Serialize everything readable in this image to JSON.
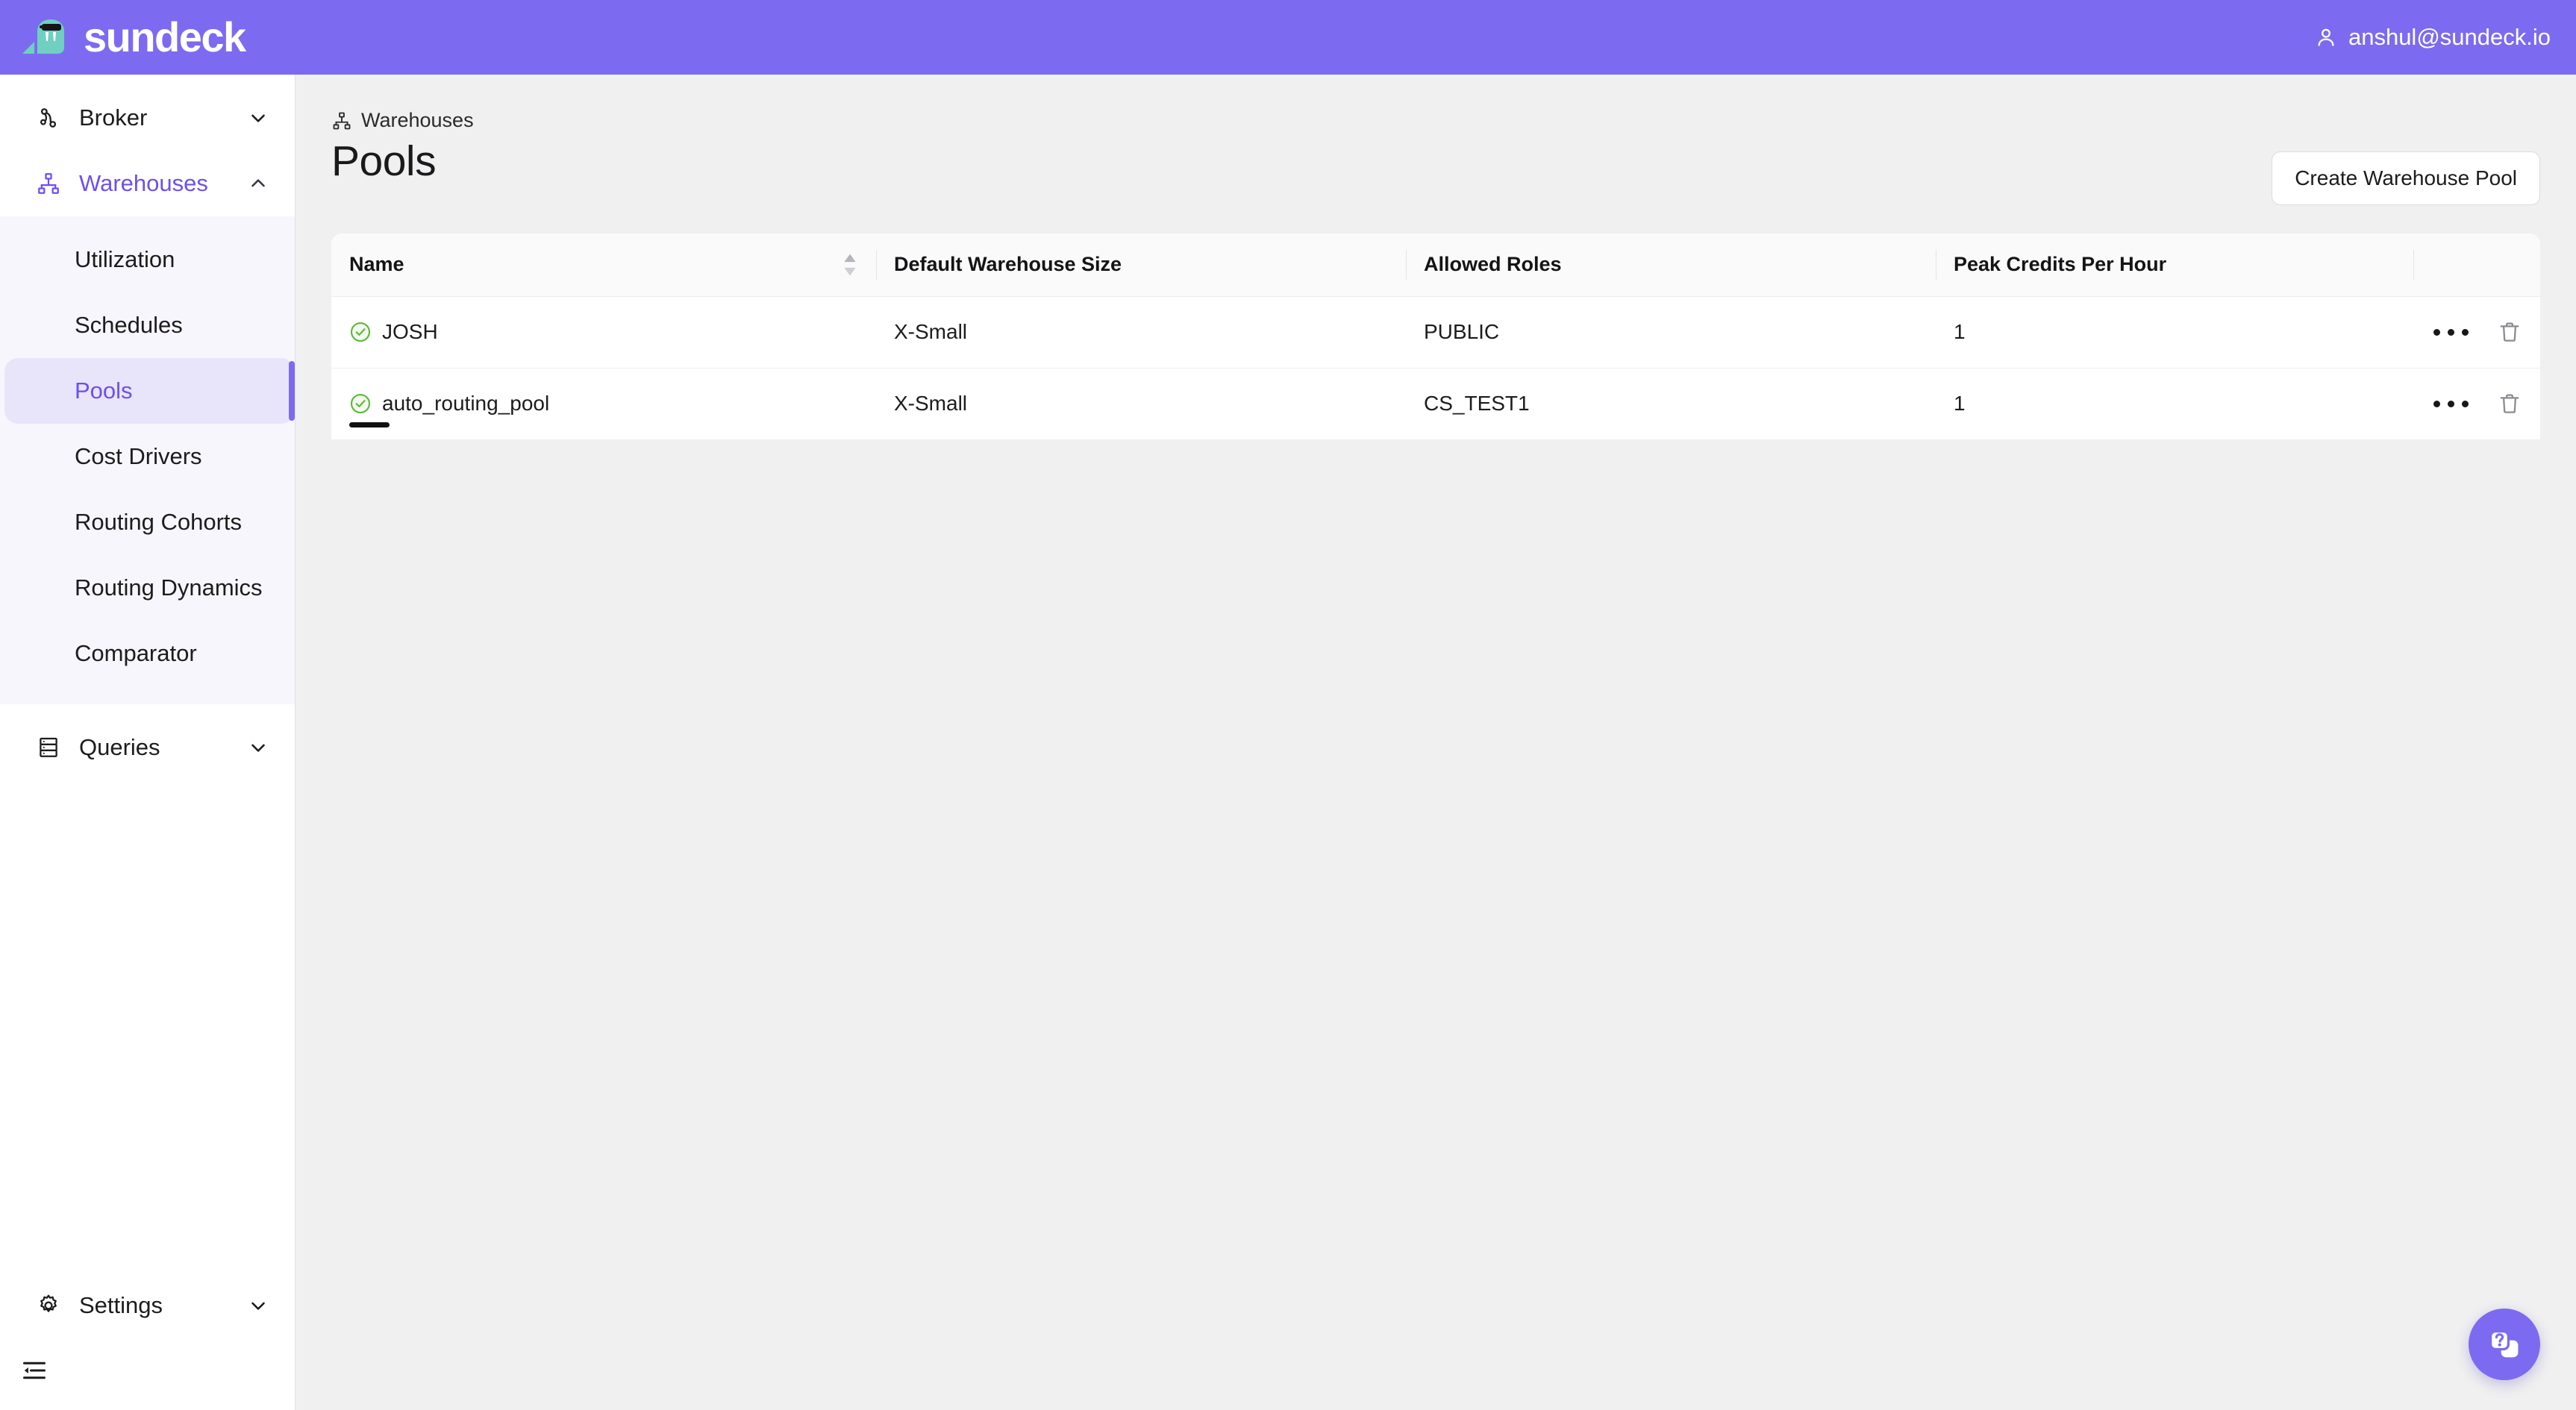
{
  "brand": {
    "name": "sundeck",
    "logo_icon": "walrus-logo-icon"
  },
  "topbar": {
    "user_icon": "user-icon",
    "user_email": "anshul@sundeck.io",
    "background_color": "#7c6bf0"
  },
  "sidebar": {
    "groups": [
      {
        "label": "Broker",
        "icon": "broker-nodes-icon",
        "chevron": "chevron-down-icon",
        "expanded": false,
        "active": false
      },
      {
        "label": "Warehouses",
        "icon": "warehouses-hierarchy-icon",
        "chevron": "chevron-up-icon",
        "expanded": true,
        "active": true
      }
    ],
    "submenu": [
      {
        "label": "Utilization",
        "active": false
      },
      {
        "label": "Schedules",
        "active": false
      },
      {
        "label": "Pools",
        "active": true
      },
      {
        "label": "Cost Drivers",
        "active": false
      },
      {
        "label": "Routing Cohorts",
        "active": false
      },
      {
        "label": "Routing Dynamics",
        "active": false
      },
      {
        "label": "Comparator",
        "active": false
      }
    ],
    "queries": {
      "label": "Queries",
      "icon": "server-stack-icon",
      "chevron": "chevron-down-icon"
    },
    "settings": {
      "label": "Settings",
      "icon": "gear-icon",
      "chevron": "chevron-down-icon"
    },
    "collapse": {
      "icon": "collapse-sidebar-icon"
    },
    "accent_color": "#6c4ff0",
    "submenu_background": "#f8f6fd",
    "active_item_background": "#e8e5fa"
  },
  "main": {
    "breadcrumb": {
      "icon": "warehouses-hierarchy-icon",
      "label": "Warehouses"
    },
    "page_title": "Pools",
    "create_button": "Create Warehouse Pool"
  },
  "table": {
    "columns": [
      {
        "key": "name",
        "label": "Name",
        "sortable": true,
        "sort_icon": "sort-arrows-icon"
      },
      {
        "key": "size",
        "label": "Default Warehouse Size",
        "sortable": false
      },
      {
        "key": "roles",
        "label": "Allowed Roles",
        "sortable": false
      },
      {
        "key": "peak",
        "label": "Peak Credits Per Hour",
        "sortable": false
      },
      {
        "key": "actions",
        "label": "",
        "sortable": false
      }
    ],
    "rows": [
      {
        "status_icon": "check-circle-icon",
        "status_color": "#5cb83c",
        "name": "JOSH",
        "size": "X-Small",
        "roles": "PUBLIC",
        "peak": "1",
        "menu_icon": "more-options-icon",
        "delete_icon": "trash-icon",
        "caret": false
      },
      {
        "status_icon": "check-circle-icon",
        "status_color": "#5cb83c",
        "name": "auto_routing_pool",
        "size": "X-Small",
        "roles": "CS_TEST1",
        "peak": "1",
        "menu_icon": "more-options-icon",
        "delete_icon": "trash-icon",
        "caret": true
      }
    ]
  },
  "help_fab": {
    "icon": "help-cards-icon",
    "color": "#7c6bf0"
  }
}
